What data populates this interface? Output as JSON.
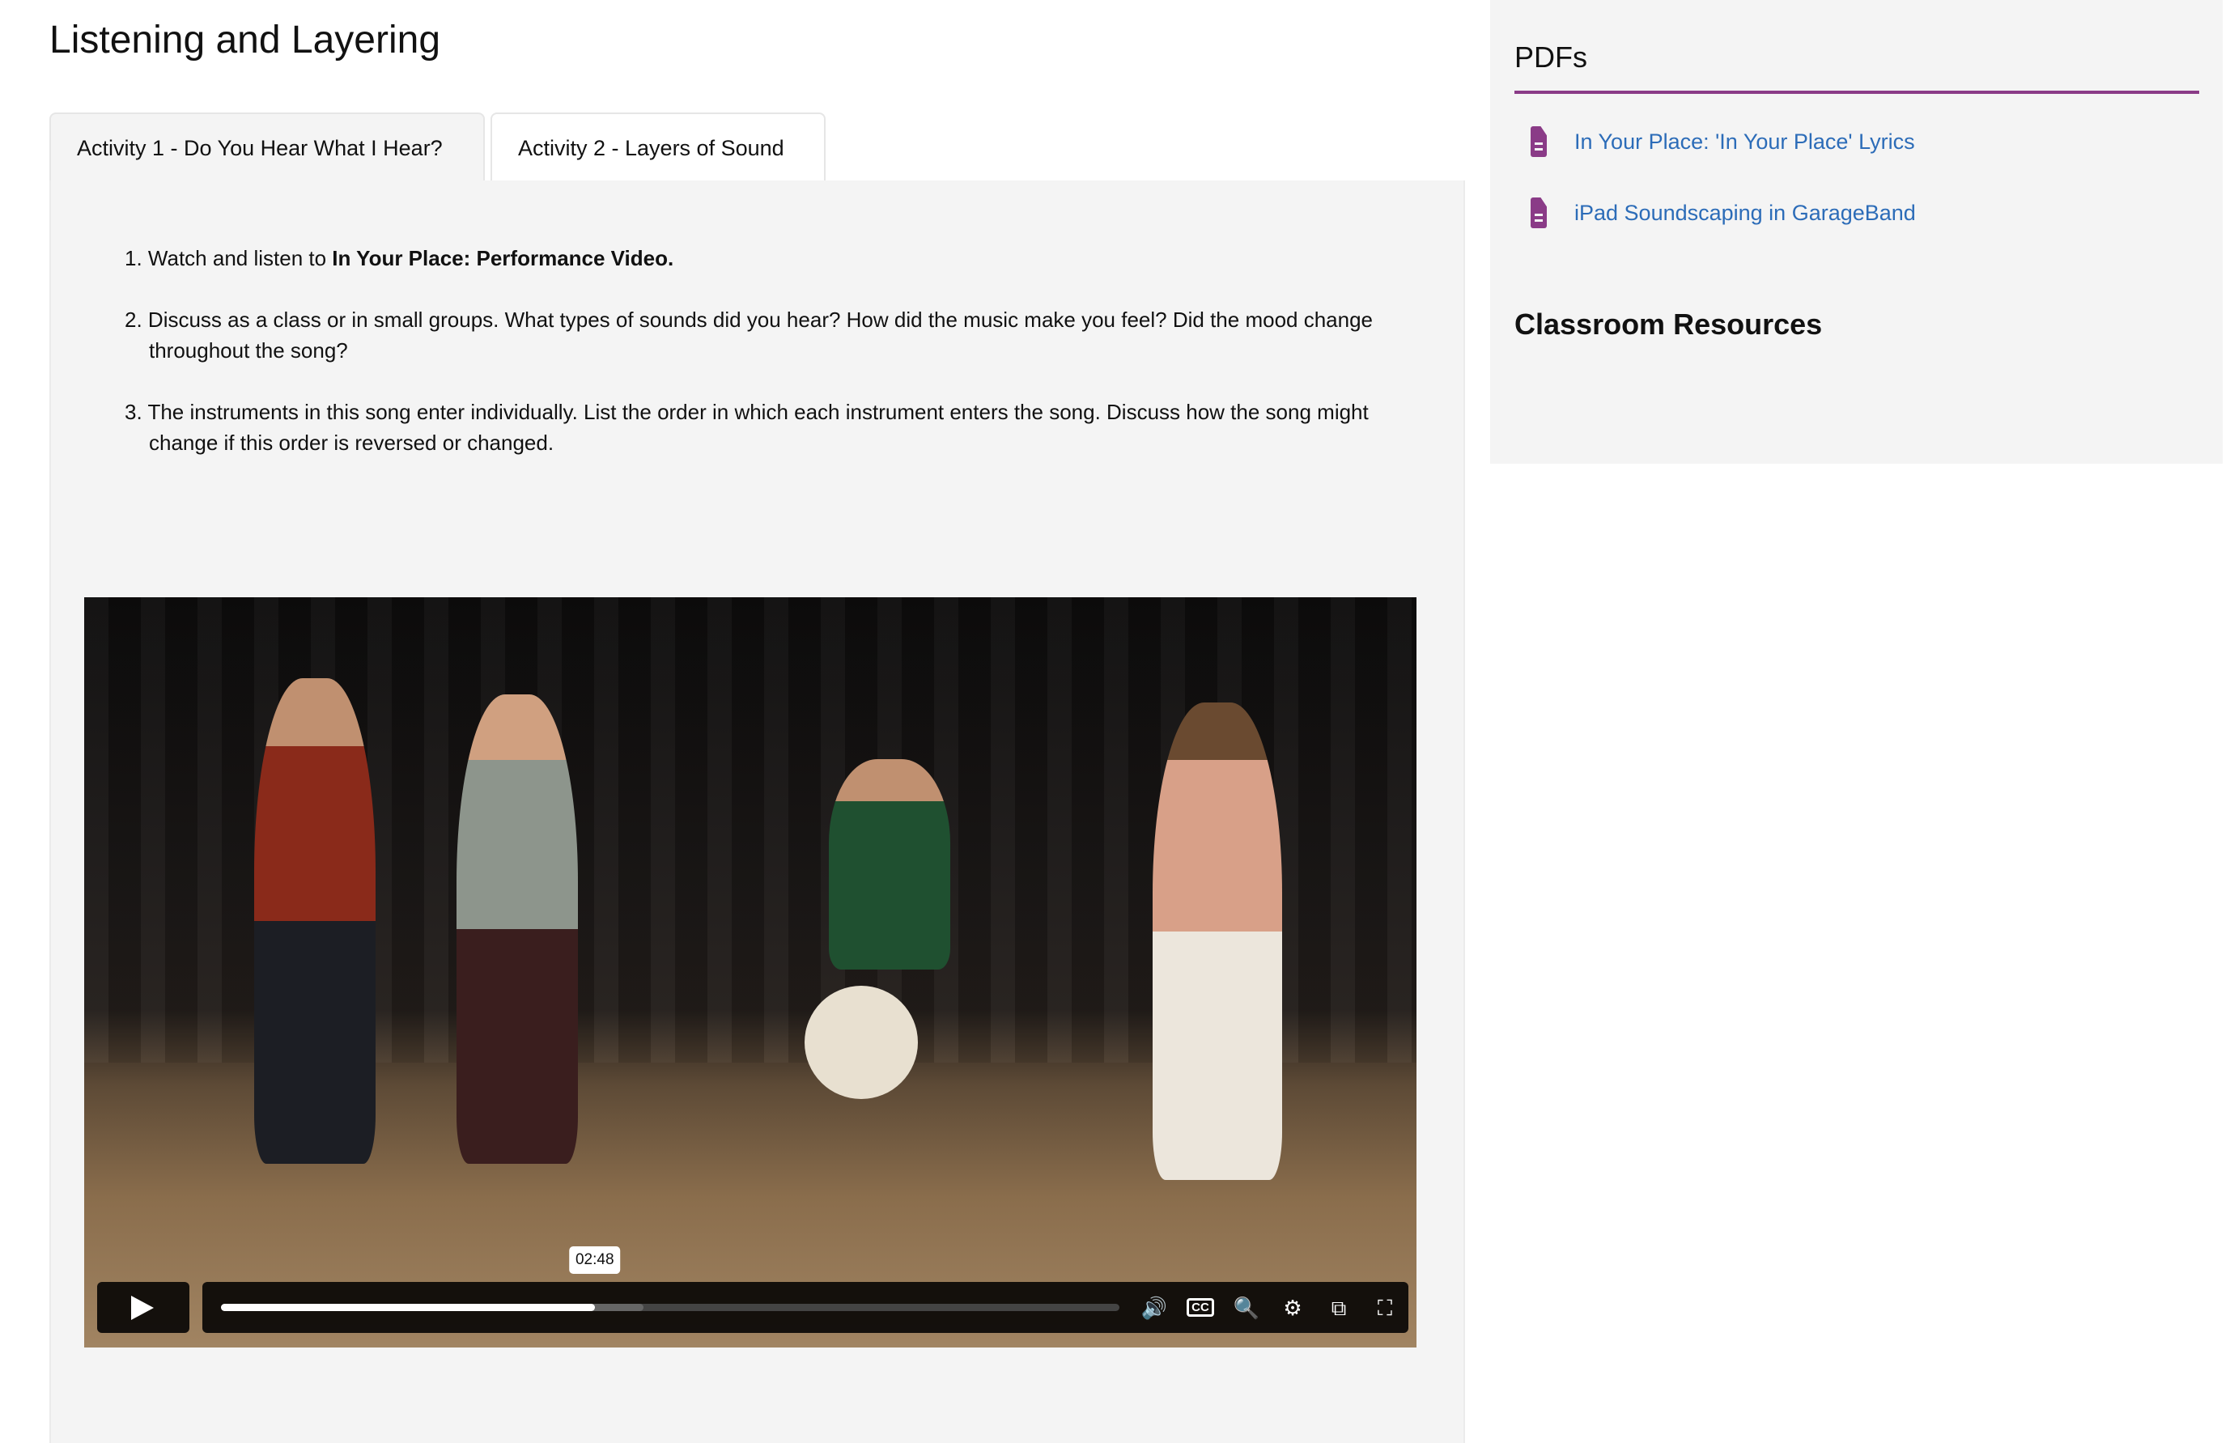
{
  "page": {
    "title": "Listening and Layering"
  },
  "tabs": [
    {
      "label": "Activity 1 - Do You Hear What I Hear?",
      "active": false
    },
    {
      "label": "Activity 2 - Layers of Sound",
      "active": true
    }
  ],
  "steps": [
    {
      "number": "1.",
      "text": "Watch and listen to ",
      "bold": "In Your Place: Performance Video."
    },
    {
      "number": "2.",
      "text": "Discuss as a class or in small groups. What types of sounds did you hear? How did the music make you feel? Did the mood change throughout the song?"
    },
    {
      "number": "3.",
      "text": "The instruments in this song enter individually.  List the order in which each instrument enters the song. Discuss how the song might change if this order is reversed or changed."
    }
  ],
  "video": {
    "tooltip_time": "02:48",
    "progress_percent": 41.6,
    "buffered_percent": 47,
    "controls": [
      "play-icon",
      "volume-icon",
      "closed-captions-icon",
      "transcript-search-icon",
      "settings-gear-icon",
      "picture-in-picture-icon",
      "fullscreen-icon"
    ]
  },
  "sidebar": {
    "pdfs_heading": "PDFs",
    "pdfs": [
      {
        "label": "In Your Place: 'In Your Place' Lyrics",
        "icon": "document-icon"
      },
      {
        "label": "iPad Soundscaping in GarageBand",
        "icon": "document-icon"
      }
    ],
    "resources_heading": "Classroom Resources"
  },
  "colors": {
    "accent": "#8a3b87",
    "link": "#2c6cb8",
    "panel": "#f4f4f4"
  }
}
